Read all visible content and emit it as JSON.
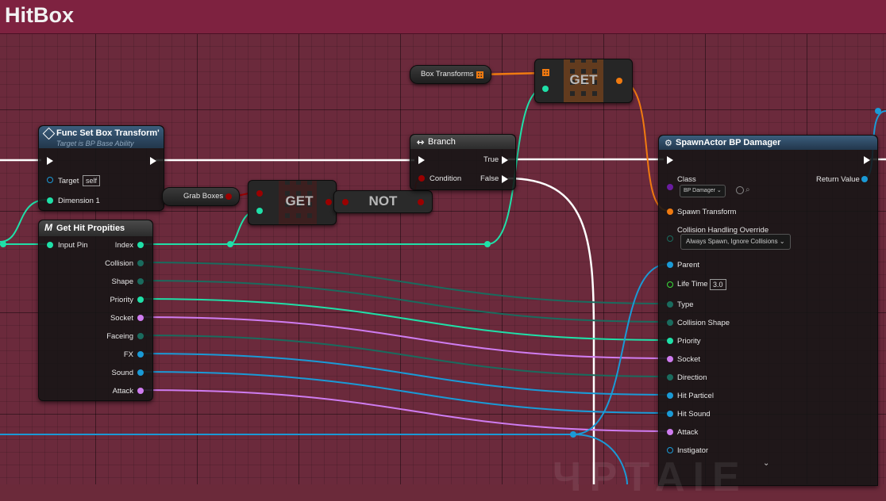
{
  "title": "HitBox",
  "nodes": {
    "func_set_box_transform": {
      "title": "Func Set Box Transform'",
      "subtitle": "Target is BP Base Ability",
      "target_label": "Target",
      "target_value": "self",
      "dimension_label": "Dimension 1"
    },
    "get_hit_propities": {
      "title": "Get Hit Propities",
      "input_label": "Input Pin",
      "outputs": [
        "Index",
        "Collision",
        "Shape",
        "Priority",
        "Socket",
        "Faceing",
        "FX",
        "Sound",
        "Attack"
      ]
    },
    "grab_boxes": {
      "label": "Grab Boxes"
    },
    "get_1": {
      "label": "GET"
    },
    "not": {
      "label": "NOT"
    },
    "box_transforms": {
      "label": "Box Transforms"
    },
    "get_2": {
      "label": "GET"
    },
    "branch": {
      "title": "Branch",
      "condition_label": "Condition",
      "true_label": "True",
      "false_label": "False"
    },
    "spawn_actor": {
      "title": "SpawnActor BP Damager",
      "class_label": "Class",
      "class_value": "BP Damager",
      "return_label": "Return Value",
      "spawn_transform_label": "Spawn Transform",
      "collision_override_label": "Collision Handling Override",
      "collision_override_value": "Always Spawn, Ignore Collisions",
      "parent_label": "Parent",
      "life_time_label": "Life Time",
      "life_time_value": "3.0",
      "inputs": [
        "Type",
        "Collision Shape",
        "Priority",
        "Socket",
        "Direction",
        "Hit Particel",
        "Hit Sound",
        "Attack",
        "Instigator"
      ]
    }
  },
  "colors": {
    "exec": "#ffffff",
    "int": "#1fe0a8",
    "struct": "#1a6b5e",
    "transform": "#f07a10",
    "bool": "#9a0000",
    "object": "#1a9ad6",
    "string": "#cf7cf0",
    "float": "#3adc3a",
    "class": "#6a1ca0",
    "title_bar": "#7e2240"
  },
  "watermark": "ЧРТАІЕ"
}
